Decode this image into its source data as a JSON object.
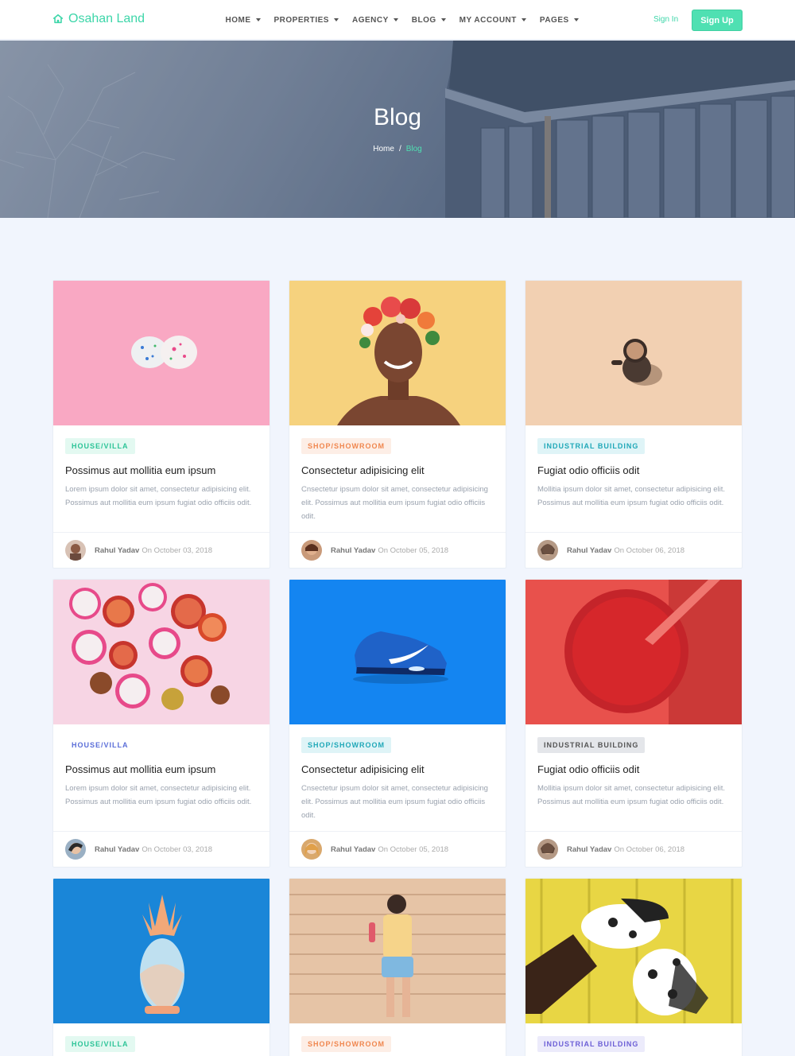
{
  "brand": {
    "name": "Osahan Land"
  },
  "nav": {
    "items": [
      "HOME",
      "PROPERTIES",
      "AGENCY",
      "BLOG",
      "MY ACCOUNT",
      "PAGES"
    ],
    "signin": "Sign In",
    "signup": "Sign Up"
  },
  "hero": {
    "title": "Blog",
    "crumb_home": "Home",
    "crumb_sep": "/",
    "crumb_current": "Blog"
  },
  "posts": [
    {
      "category": "HOUSE/VILLA",
      "title": "Possimus aut mollitia eum ipsum",
      "text": "Lorem ipsum dolor sit amet, consectetur adipisicing elit. Possimus aut mollitia eum ipsum fugiat odio officiis odit.",
      "author": "Rahul Yadav",
      "date": "On October 03, 2018"
    },
    {
      "category": "SHOP/SHOWROOM",
      "title": "Consectetur adipisicing elit",
      "text": "Cnsectetur ipsum dolor sit amet, consectetur adipisicing elit. Possimus aut mollitia eum ipsum fugiat odio officiis odit.",
      "author": "Rahul Yadav",
      "date": "On October 05, 2018"
    },
    {
      "category": "INDUSTRIAL BUILDING",
      "title": "Fugiat odio officiis odit",
      "text": "Mollitia ipsum dolor sit amet, consectetur adipisicing elit. Possimus aut mollitia eum ipsum fugiat odio officiis odit.",
      "author": "Rahul Yadav",
      "date": "On October 06, 2018"
    },
    {
      "category": "HOUSE/VILLA",
      "title": "Possimus aut mollitia eum ipsum",
      "text": "Lorem ipsum dolor sit amet, consectetur adipisicing elit. Possimus aut mollitia eum ipsum fugiat odio officiis odit.",
      "author": "Rahul Yadav",
      "date": "On October 03, 2018"
    },
    {
      "category": "SHOP/SHOWROOM",
      "title": "Consectetur adipisicing elit",
      "text": "Cnsectetur ipsum dolor sit amet, consectetur adipisicing elit. Possimus aut mollitia eum ipsum fugiat odio officiis odit.",
      "author": "Rahul Yadav",
      "date": "On October 05, 2018"
    },
    {
      "category": "INDUSTRIAL BUILDING",
      "title": "Fugiat odio officiis odit",
      "text": "Mollitia ipsum dolor sit amet, consectetur adipisicing elit. Possimus aut mollitia eum ipsum fugiat odio officiis odit.",
      "author": "Rahul Yadav",
      "date": "On October 06, 2018"
    },
    {
      "category": "HOUSE/VILLA"
    },
    {
      "category": "SHOP/SHOWROOM"
    },
    {
      "category": "INDUSTRIAL BUILDING"
    }
  ],
  "badge_colors": {
    "green": {
      "bg": "#e3f9f1",
      "fg": "#2cc497"
    },
    "orange": {
      "bg": "#fdeee6",
      "fg": "#f0874f"
    },
    "teal": {
      "bg": "#dff4f7",
      "fg": "#20a8b8"
    },
    "blue": {
      "bg": "#ffffff",
      "fg": "#5b6ed8"
    },
    "gray": {
      "bg": "#e4e6ea",
      "fg": "#555555"
    },
    "indigo": {
      "bg": "#ecebfb",
      "fg": "#6c5fd6"
    }
  },
  "accent": "#4fe0b2"
}
